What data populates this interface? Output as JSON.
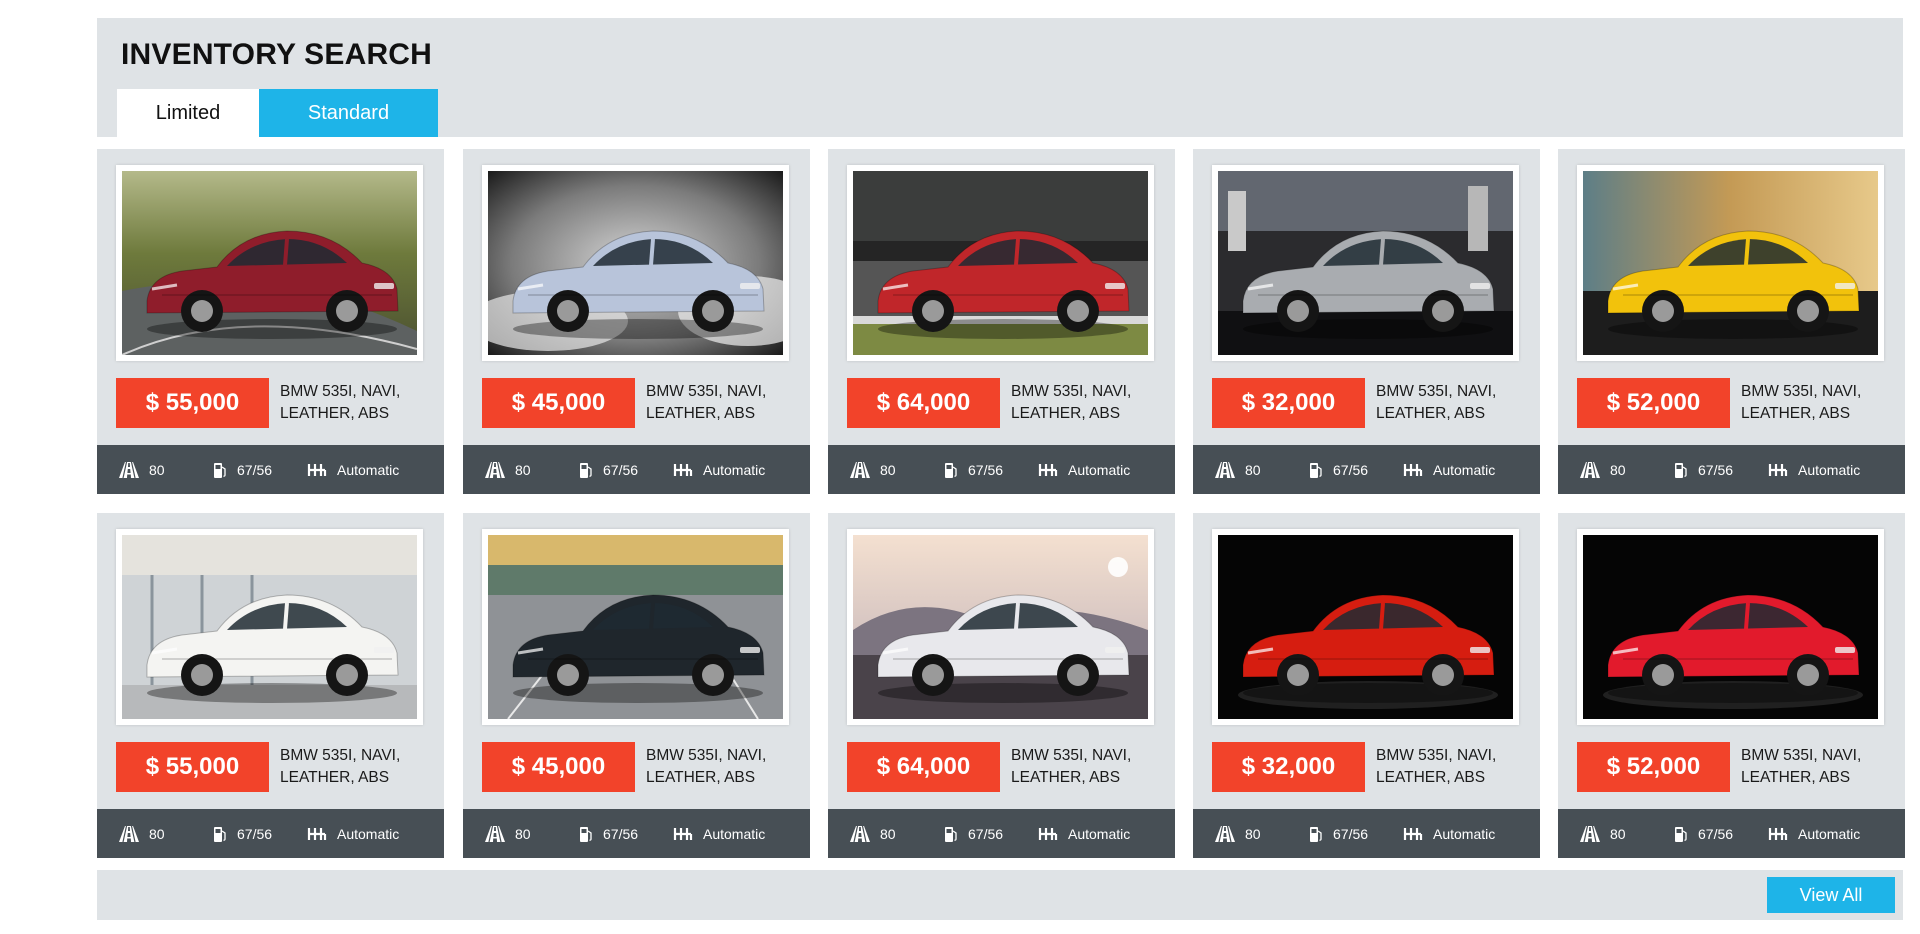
{
  "header": {
    "title": "INVENTORY SEARCH",
    "tabs": [
      {
        "label": "Limited"
      },
      {
        "label": "Standard"
      }
    ]
  },
  "colors": {
    "accent": "#1eb4e8",
    "price": "#f2432a",
    "panel": "#dfe3e6",
    "spec_bar": "#474f55"
  },
  "cards": [
    {
      "price": "$ 55,000",
      "desc1": "BMW 535I, NAVI,",
      "desc2": "LEATHER, ABS",
      "spec1": "80",
      "spec2": "67/56",
      "spec3": "Automatic",
      "car_color": "#8f1d2b",
      "scene": "hill-road"
    },
    {
      "price": "$ 45,000",
      "desc1": "BMW 535I, NAVI,",
      "desc2": "LEATHER, ABS",
      "spec1": "80",
      "spec2": "67/56",
      "spec3": "Automatic",
      "car_color": "#b8c4da",
      "scene": "smoke"
    },
    {
      "price": "$ 64,000",
      "desc1": "BMW 535I, NAVI,",
      "desc2": "LEATHER, ABS",
      "spec1": "80",
      "spec2": "67/56",
      "spec3": "Automatic",
      "car_color": "#c0262a",
      "scene": "track"
    },
    {
      "price": "$ 32,000",
      "desc1": "BMW 535I, NAVI,",
      "desc2": "LEATHER, ABS",
      "spec1": "80",
      "spec2": "67/56",
      "spec3": "Automatic",
      "car_color": "#a9acb0",
      "scene": "showroom"
    },
    {
      "price": "$ 52,000",
      "desc1": "BMW 535I, NAVI,",
      "desc2": "LEATHER, ABS",
      "spec1": "80",
      "spec2": "67/56",
      "spec3": "Automatic",
      "car_color": "#f2c20c",
      "scene": "exhibit"
    },
    {
      "price": "$ 55,000",
      "desc1": "BMW 535I, NAVI,",
      "desc2": "LEATHER, ABS",
      "spec1": "80",
      "spec2": "67/56",
      "spec3": "Automatic",
      "car_color": "#f4f4f2",
      "scene": "garage"
    },
    {
      "price": "$ 45,000",
      "desc1": "BMW 535I, NAVI,",
      "desc2": "LEATHER, ABS",
      "spec1": "80",
      "spec2": "67/56",
      "spec3": "Automatic",
      "car_color": "#1f262c",
      "scene": "parking"
    },
    {
      "price": "$ 64,000",
      "desc1": "BMW 535I, NAVI,",
      "desc2": "LEATHER, ABS",
      "spec1": "80",
      "spec2": "67/56",
      "spec3": "Automatic",
      "car_color": "#e8e8ec",
      "scene": "sunset"
    },
    {
      "price": "$ 32,000",
      "desc1": "BMW 535I, NAVI,",
      "desc2": "LEATHER, ABS",
      "spec1": "80",
      "spec2": "67/56",
      "spec3": "Automatic",
      "car_color": "#d61d10",
      "scene": "black"
    },
    {
      "price": "$ 52,000",
      "desc1": "BMW 535I, NAVI,",
      "desc2": "LEATHER, ABS",
      "spec1": "80",
      "spec2": "67/56",
      "spec3": "Automatic",
      "car_color": "#e21a2c",
      "scene": "black"
    }
  ],
  "footer": {
    "view_all": "View All"
  },
  "icons": {
    "spec1": "road-icon",
    "spec2": "fuel-icon",
    "spec3": "gearbox-icon"
  }
}
